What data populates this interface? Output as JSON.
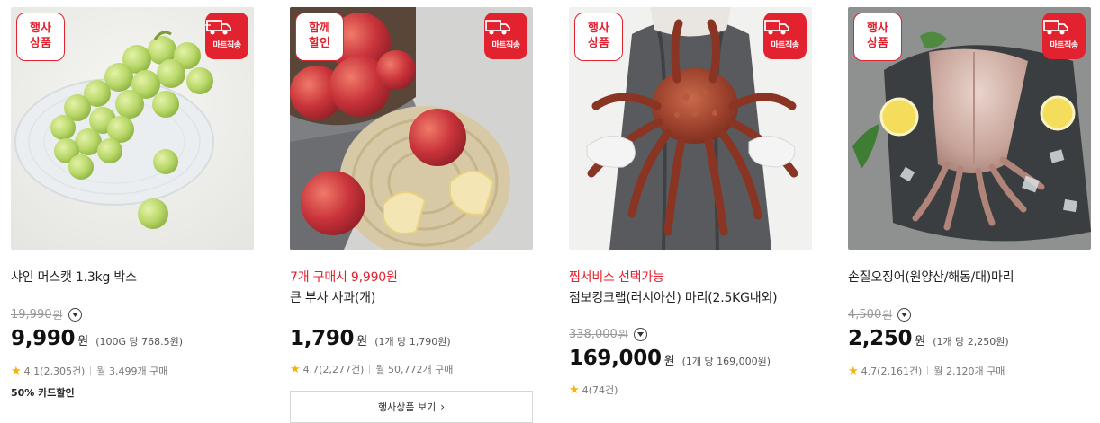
{
  "products": [
    {
      "event_badge": "행사\n상품",
      "mart_badge": "마트직송",
      "name": "샤인 머스캣 1.3kg 박스",
      "original_price": "19,990",
      "original_won": "원",
      "price": "9,990",
      "price_won": "원",
      "unit_price": "(100G 당 768.5원)",
      "rating": "4.1",
      "review_count": "(2,305건)",
      "monthly_sales": "월 3,499개 구매",
      "card_discount": "50% 카드할인"
    },
    {
      "event_badge": "함께\n할인",
      "mart_badge": "마트직송",
      "promo": "7개 구매시 9,990원",
      "name": "큰 부사 사과(개)",
      "price": "1,790",
      "price_won": "원",
      "unit_price": "(1개 당 1,790원)",
      "rating": "4.7",
      "review_count": "(2,277건)",
      "monthly_sales": "월 50,772개 구매",
      "event_button": "행사상품 보기"
    },
    {
      "event_badge": "행사\n상품",
      "mart_badge": "마트직송",
      "promo": "찜서비스 선택가능",
      "name": "점보킹크랩(러시아산) 마리(2.5KG내외)",
      "original_price": "338,000",
      "original_won": "원",
      "price": "169,000",
      "price_won": "원",
      "unit_price": "(1개 당 169,000원)",
      "rating": "4",
      "review_count": "(74건)"
    },
    {
      "event_badge": "행사\n상품",
      "mart_badge": "마트직송",
      "name": "손질오징어(원양산/해동/대)마리",
      "original_price": "4,500",
      "original_won": "원",
      "price": "2,250",
      "price_won": "원",
      "unit_price": "(1개 당 2,250원)",
      "rating": "4.7",
      "review_count": "(2,161건)",
      "monthly_sales": "월 2,120개 구매"
    }
  ],
  "colors": {
    "accent_red": "#e3222f",
    "star_yellow": "#f6b20d"
  },
  "icons": {
    "mart_badge": "delivery-truck-icon",
    "expand_price": "chevron-down-icon",
    "rating": "star-icon",
    "event_button": "chevron-right-icon"
  }
}
